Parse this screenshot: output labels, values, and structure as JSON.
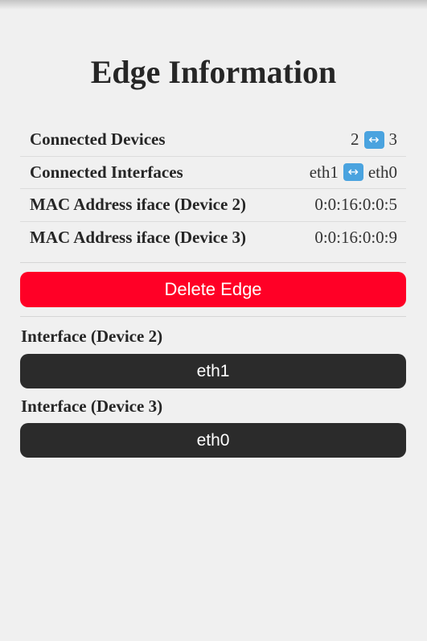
{
  "page": {
    "title": "Edge Information"
  },
  "info": {
    "connected_devices": {
      "label": "Connected Devices",
      "left": "2",
      "right": "3",
      "icon": "left-right-arrow-icon"
    },
    "connected_interfaces": {
      "label": "Connected Interfaces",
      "left": "eth1",
      "right": "eth0",
      "icon": "left-right-arrow-icon"
    },
    "mac_device2": {
      "label": "MAC Address iface (Device 2)",
      "value": "0:0:16:0:0:5"
    },
    "mac_device3": {
      "label": "MAC Address iface (Device 3)",
      "value": "0:0:16:0:0:9"
    }
  },
  "actions": {
    "delete_label": "Delete Edge"
  },
  "interfaces": {
    "device2": {
      "label": "Interface (Device 2)",
      "value": "eth1"
    },
    "device3": {
      "label": "Interface (Device 3)",
      "value": "eth0"
    }
  },
  "colors": {
    "delete": "#ff0026",
    "interface_button": "#2b2b2b",
    "arrow_icon_bg": "#4aa3df",
    "background": "#f0f0f0"
  }
}
